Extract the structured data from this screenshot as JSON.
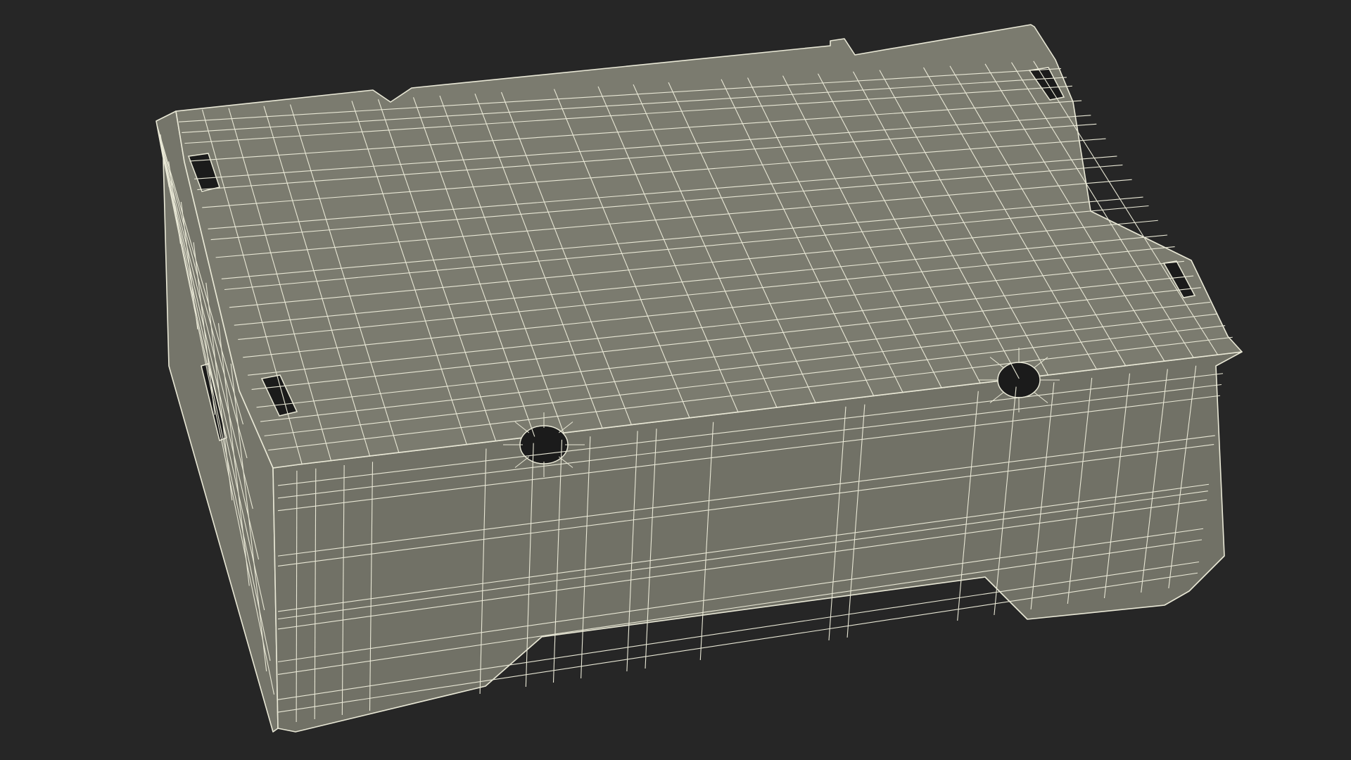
{
  "scene": {
    "subject": "box-wireframe-render",
    "colors": {
      "background": "#262626",
      "surface_top": "#7b7b6f",
      "surface_side": "#75756a",
      "surface_front": "#717166",
      "wire": "#e9e8d6",
      "hole": "#1b1b1b"
    }
  }
}
